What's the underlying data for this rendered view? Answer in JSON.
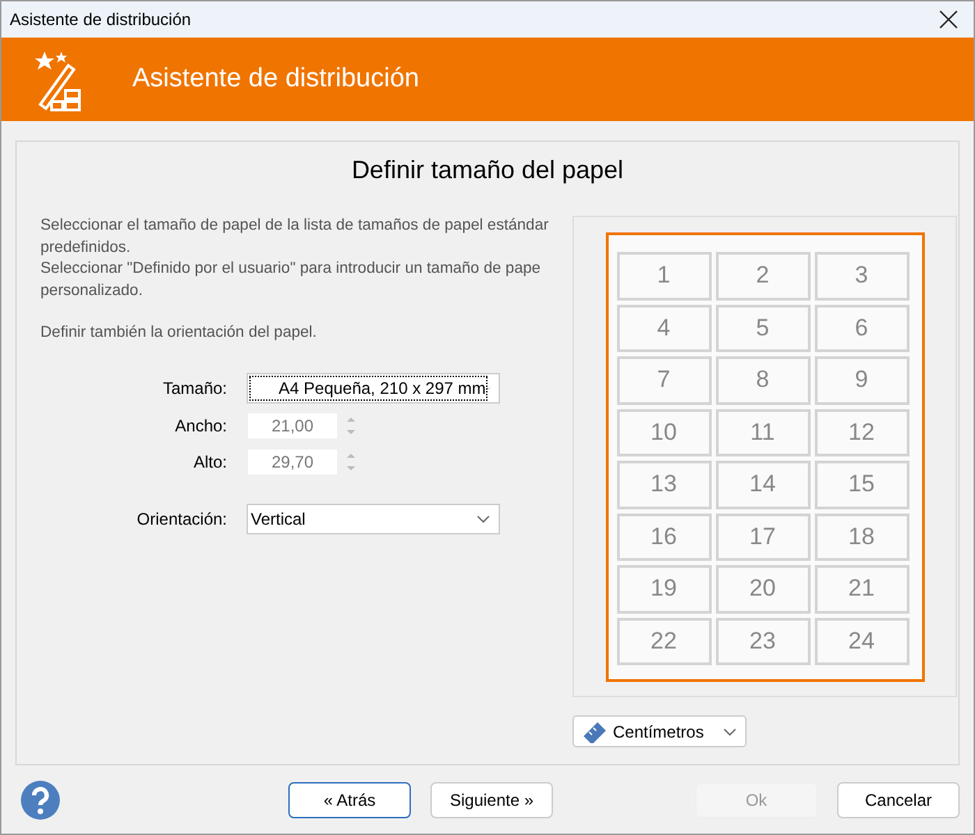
{
  "window": {
    "title": "Asistente de distribución"
  },
  "header": {
    "title": "Asistente de distribución"
  },
  "page": {
    "title": "Definir tamaño del papel"
  },
  "description": [
    [
      "Seleccionar el tamaño de papel de la lista de tamaños de papel estándar",
      "predefinidos.",
      "Seleccionar \"Definido por el usuario\" para introducir un tamaño de pape",
      "personalizado."
    ],
    [
      "Definir también la orientación del papel."
    ]
  ],
  "fields": [
    {
      "kind": "select",
      "label": "Tamaño:",
      "value": "A4 Pequeña, 210 x 297 mm",
      "focused": true
    },
    {
      "kind": "spin",
      "label": "Ancho:",
      "value": "21,00",
      "disabled": true
    },
    {
      "kind": "spin",
      "label": "Alto:",
      "value": "29,70",
      "disabled": true
    },
    {
      "kind": "select",
      "label": "Orientación:",
      "value": "Vertical",
      "focused": false
    }
  ],
  "preview": {
    "cells": [
      "1",
      "2",
      "3",
      "4",
      "5",
      "6",
      "7",
      "8",
      "9",
      "10",
      "11",
      "12",
      "13",
      "14",
      "15",
      "16",
      "17",
      "18",
      "19",
      "20",
      "21",
      "22",
      "23",
      "24"
    ]
  },
  "units": {
    "value": "Centímetros"
  },
  "buttons": [
    {
      "label": "« Atrás",
      "focused": true,
      "disabled": false
    },
    {
      "label": "Siguiente »",
      "focused": false,
      "disabled": false
    },
    {
      "label": "Ok",
      "focused": false,
      "disabled": true
    },
    {
      "label": "Cancelar",
      "focused": false,
      "disabled": false
    }
  ]
}
